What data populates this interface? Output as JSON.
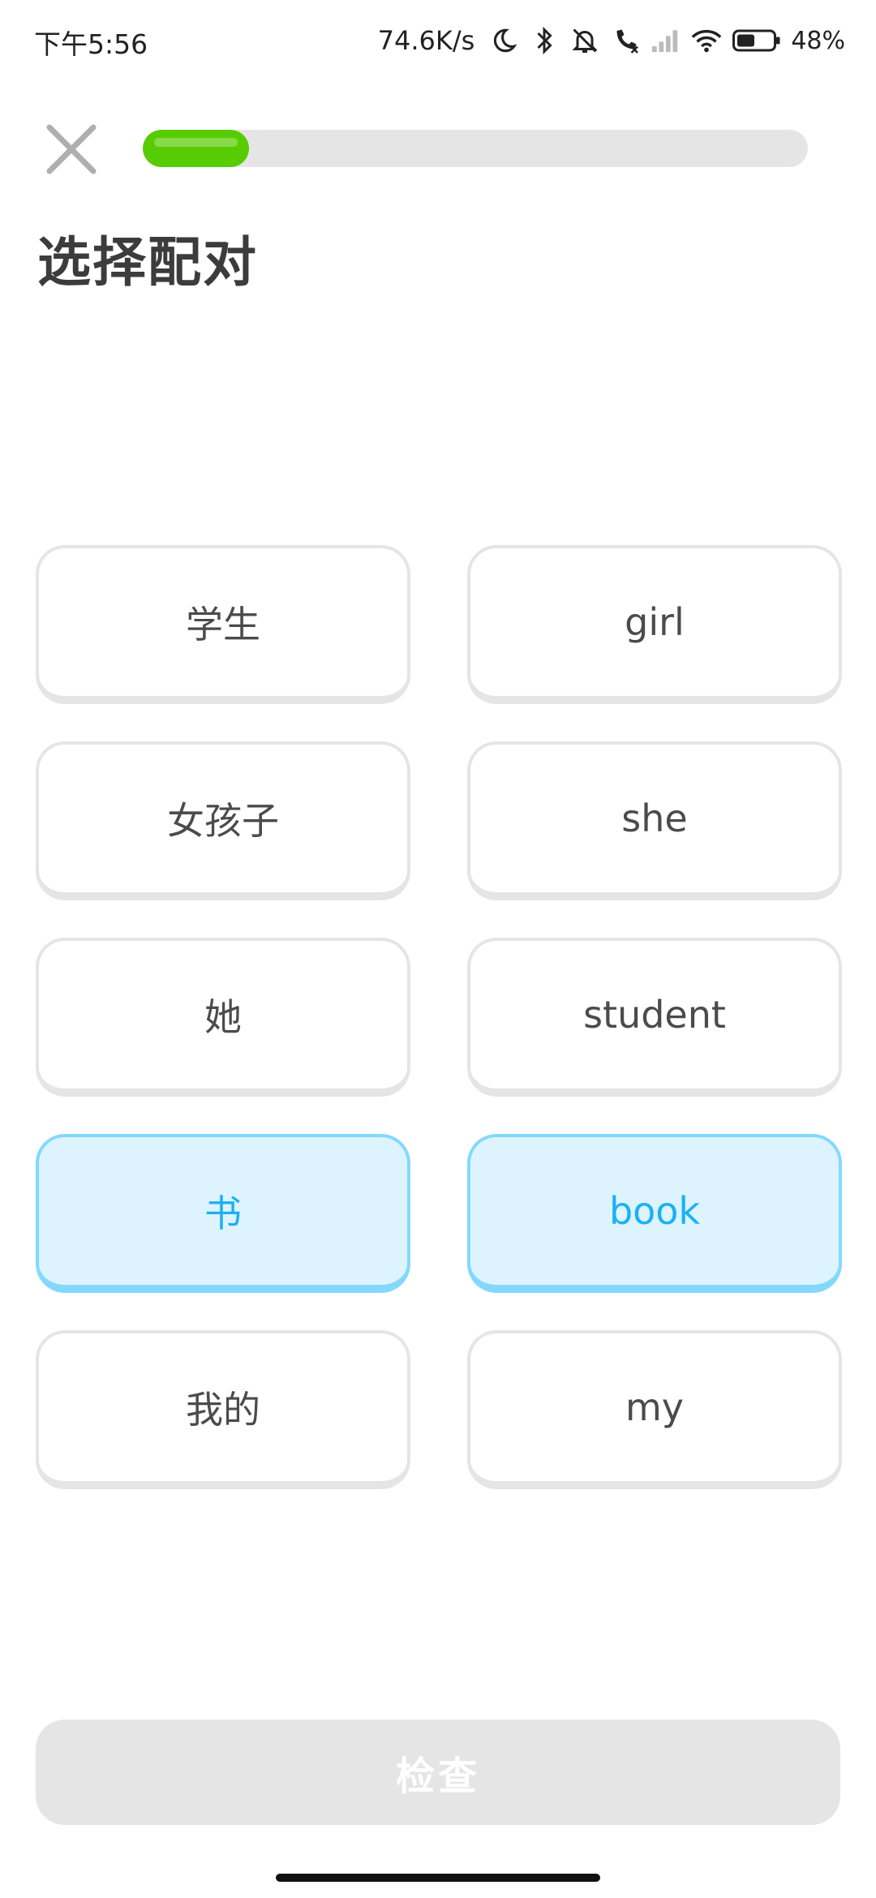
{
  "status_bar": {
    "time": "下午5:56",
    "net_speed": "74.6K/s",
    "battery_percent": "48%",
    "icons": [
      "moon-icon",
      "bluetooth-icon",
      "mute-bell-icon",
      "call-icon",
      "signal-icon",
      "wifi-icon",
      "battery-icon"
    ]
  },
  "progress": {
    "value": 0.16,
    "color": "#58cc02",
    "track_color": "#e5e5e5"
  },
  "title": "选择配对",
  "tiles": {
    "left": [
      {
        "label": "学生",
        "selected": false
      },
      {
        "label": "女孩子",
        "selected": false
      },
      {
        "label": "她",
        "selected": false
      },
      {
        "label": "书",
        "selected": true
      },
      {
        "label": "我的",
        "selected": false
      }
    ],
    "right": [
      {
        "label": "girl",
        "selected": false
      },
      {
        "label": "she",
        "selected": false
      },
      {
        "label": "student",
        "selected": false
      },
      {
        "label": "book",
        "selected": true
      },
      {
        "label": "my",
        "selected": false
      }
    ]
  },
  "check_button": {
    "label": "检查",
    "disabled": true
  },
  "colors": {
    "selected_bg": "#ddf4ff",
    "selected_border": "#84d8ff",
    "selected_text": "#1cb0f6",
    "tile_border": "#e5e5e5"
  }
}
